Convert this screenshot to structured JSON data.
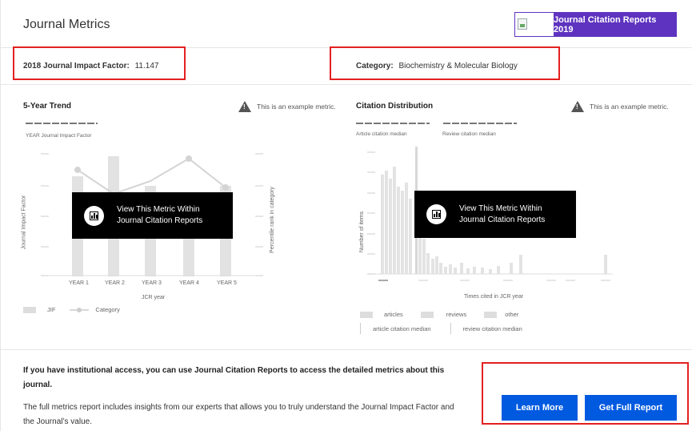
{
  "header": {
    "title": "Journal Metrics",
    "jcr_badge_label": "Journal Citation Reports 2019"
  },
  "info": {
    "jif_label": "2018 Journal Impact Factor:",
    "jif_value": "11.147",
    "category_label": "Category:",
    "category_value": "Biochemistry & Molecular Biology"
  },
  "five_year": {
    "title": "5-Year Trend",
    "notice": "This is an example metric.",
    "sub_legend": "YEAR  Journal Impact Factor",
    "ylabel_left": "Journal Impact Factor",
    "ylabel_right": "Percentile rank in category",
    "xlabel": "JCR year",
    "years": [
      "YEAR 1",
      "YEAR 2",
      "YEAR 3",
      "YEAR 4",
      "YEAR 5"
    ],
    "legend_jif": "JIF",
    "legend_category": "Category",
    "overlay_line1": "View This Metric Within",
    "overlay_line2": "Journal Citation Reports"
  },
  "citation": {
    "title": "Citation Distribution",
    "notice": "This is an example metric.",
    "sub_left": "Article citation median",
    "sub_right": "Review citation median",
    "ylabel": "Number of items",
    "xlabel": "Times cited in JCR year",
    "legend_articles": "articles",
    "legend_reviews": "reviews",
    "legend_other": "other",
    "legend_article_median": "article citation median",
    "legend_review_median": "review citation median",
    "overlay_line1": "View This Metric Within",
    "overlay_line2": "Journal Citation Reports"
  },
  "bottom": {
    "strong_text": "If you have institutional access, you can use Journal Citation Reports to access the detailed metrics about this journal.",
    "body_text": "The full metrics report includes insights from our experts that allows you to truly understand the Journal Impact Factor and the Journal’s value.",
    "learn_more": "Learn More",
    "full_report": "Get Full Report"
  },
  "colors": {
    "accent_purple": "#5e33bf",
    "button_blue": "#005ae0",
    "highlight_red": "#e32020"
  }
}
